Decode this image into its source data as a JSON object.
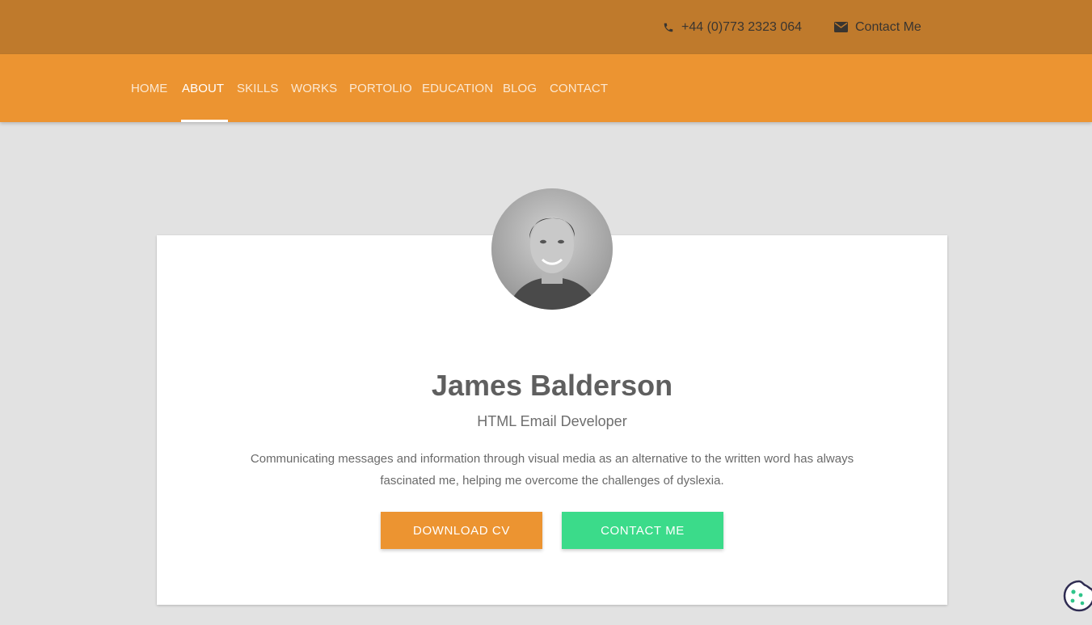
{
  "header": {
    "phone": "+44 (0)773 2323 064",
    "contact_label": "Contact Me",
    "phone_icon": "phone-icon",
    "contact_icon": "envelope-icon",
    "background": "#bf7a2c"
  },
  "nav": {
    "items": [
      {
        "label": "HOME"
      },
      {
        "label": "ABOUT"
      },
      {
        "label": "SKILLS"
      },
      {
        "label": "WORKS"
      },
      {
        "label": "PORTOLIO"
      },
      {
        "label": "EDUCATION"
      },
      {
        "label": "BLOG"
      },
      {
        "label": "CONTACT"
      }
    ],
    "active": "ABOUT",
    "background": "#ec9431"
  },
  "profile": {
    "name": "James Balderson",
    "title": "HTML Email Developer",
    "bio": "Communicating messages and information through visual media as an alternative to the written word has always fascinated me, helping me overcome the challenges of dyslexia.",
    "download_button": "DOWNLOAD CV",
    "contact_button": "CONTACT ME",
    "accent_orange": "#ec9431",
    "accent_green": "#3bdb8a"
  },
  "widgets": {
    "cookie_icon": "cookie-icon"
  }
}
